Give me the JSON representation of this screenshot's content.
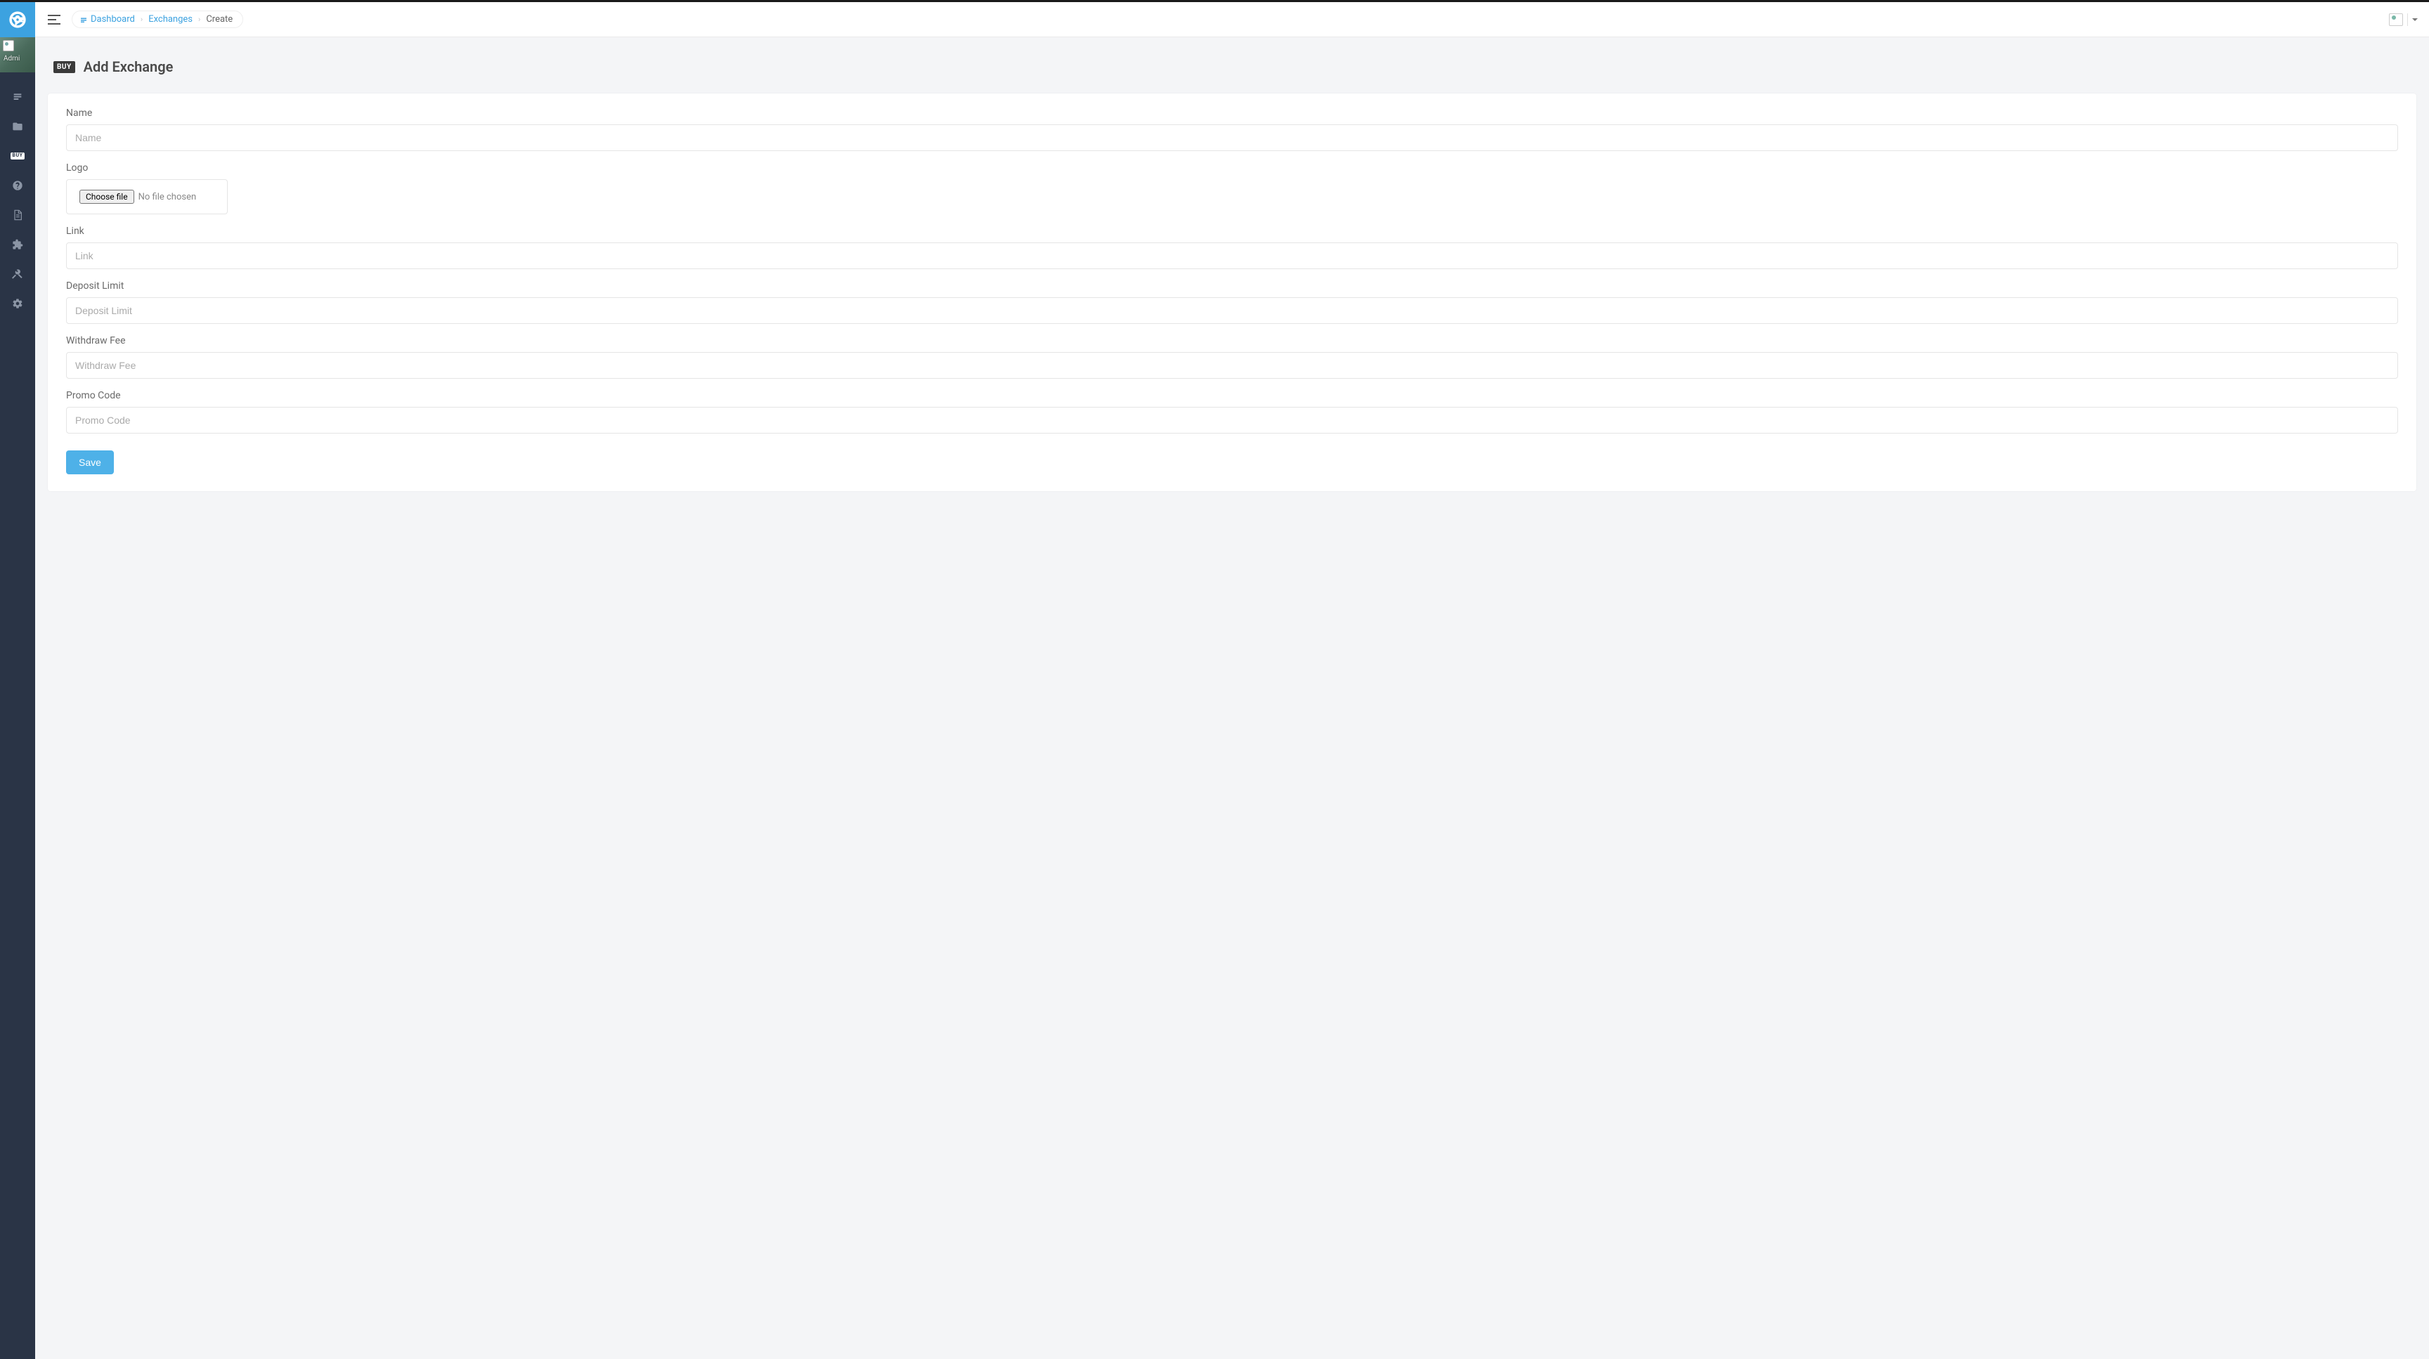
{
  "sidebar": {
    "avatar_label": "Admi",
    "buy_badge": "BUY",
    "nav_icons": [
      "dashboard",
      "folder",
      "buy",
      "help",
      "document",
      "puzzle",
      "tools",
      "settings"
    ]
  },
  "breadcrumb": {
    "dashboard": "Dashboard",
    "exchanges": "Exchanges",
    "current": "Create"
  },
  "page": {
    "badge": "BUY",
    "title": "Add Exchange"
  },
  "form": {
    "name": {
      "label": "Name",
      "placeholder": "Name",
      "value": ""
    },
    "logo": {
      "label": "Logo",
      "button": "Choose file",
      "status": "No file chosen"
    },
    "link": {
      "label": "Link",
      "placeholder": "Link",
      "value": ""
    },
    "deposit_limit": {
      "label": "Deposit Limit",
      "placeholder": "Deposit Limit",
      "value": ""
    },
    "withdraw_fee": {
      "label": "Withdraw Fee",
      "placeholder": "Withdraw Fee",
      "value": ""
    },
    "promo_code": {
      "label": "Promo Code",
      "placeholder": "Promo Code",
      "value": ""
    },
    "save_label": "Save"
  }
}
